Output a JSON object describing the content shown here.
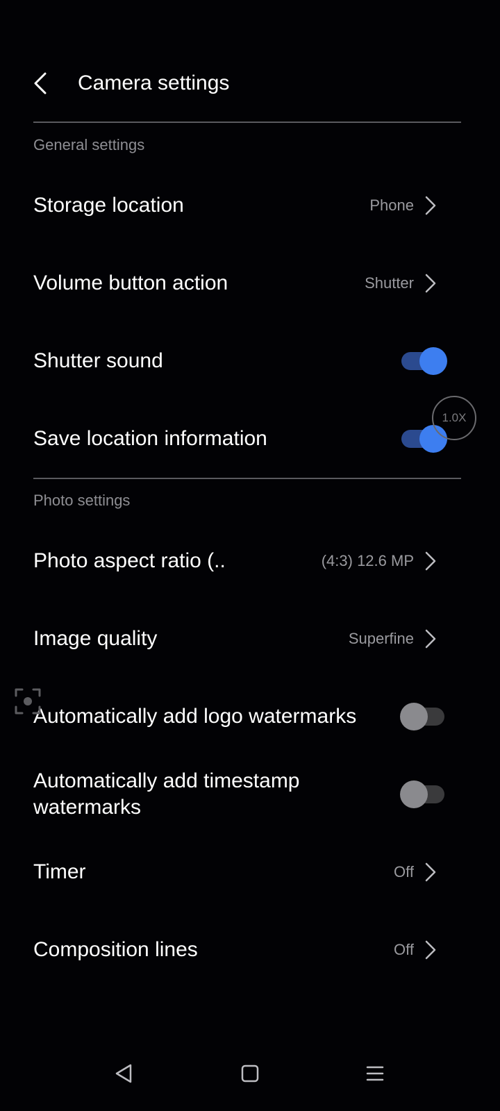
{
  "header": {
    "title": "Camera settings"
  },
  "sections": {
    "general": {
      "label": "General settings"
    },
    "photo": {
      "label": "Photo settings"
    }
  },
  "rows": {
    "storage_location": {
      "label": "Storage location",
      "value": "Phone"
    },
    "volume_button_action": {
      "label": "Volume button action",
      "value": "Shutter"
    },
    "shutter_sound": {
      "label": "Shutter sound",
      "enabled": true
    },
    "save_location": {
      "label": "Save location information",
      "enabled": true
    },
    "photo_aspect_ratio": {
      "label": "Photo aspect ratio (..",
      "value": "(4:3) 12.6 MP"
    },
    "image_quality": {
      "label": "Image quality",
      "value": "Superfine"
    },
    "logo_watermarks": {
      "label": "Automatically add logo watermarks",
      "enabled": false
    },
    "timestamp_watermarks": {
      "label": "Automatically add timestamp watermarks",
      "enabled": false
    },
    "timer": {
      "label": "Timer",
      "value": "Off"
    },
    "composition_lines": {
      "label": "Composition lines",
      "value": "Off"
    }
  },
  "overlay": {
    "zoom_level": "1.0X"
  },
  "colors": {
    "accent": "#3d7ef0",
    "background": "#020205",
    "secondary_text": "#9a9a9f"
  },
  "icons": {
    "back": "chevron-left-icon",
    "row_chevron": "chevron-right-icon",
    "focus": "focus-frame-icon",
    "nav_back": "triangle-back-icon",
    "nav_home": "square-home-icon",
    "nav_recents": "menu-lines-icon"
  }
}
